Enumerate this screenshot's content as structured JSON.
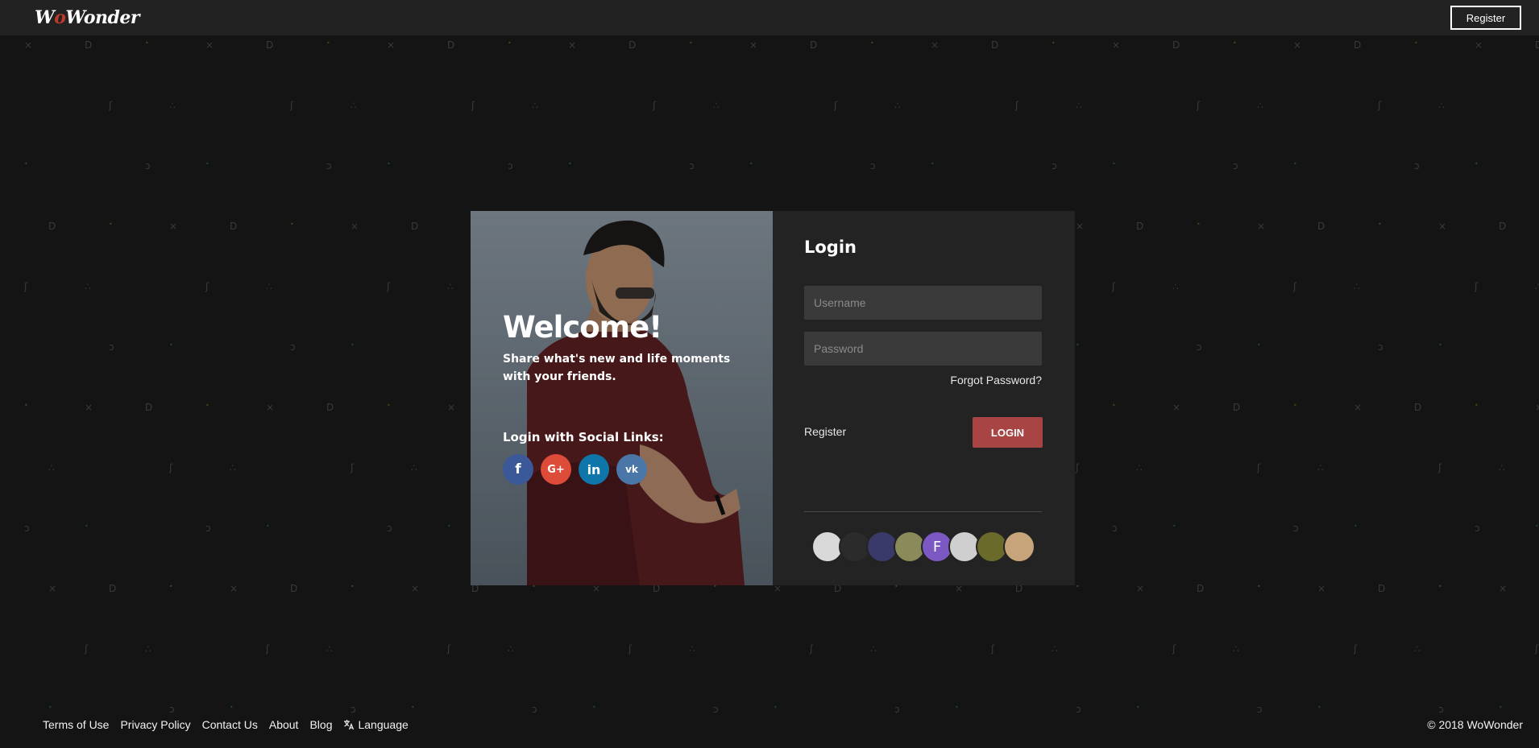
{
  "header": {
    "logo_text_start": "W",
    "logo_text_o": "o",
    "logo_text_end": "Wonder",
    "register_label": "Register"
  },
  "hero": {
    "welcome": "Welcome!",
    "tagline": "Share what's new and life moments with your friends.",
    "social_title": "Login with Social Links:",
    "social": [
      {
        "glyph": "f",
        "service": "facebook"
      },
      {
        "glyph": "G+",
        "service": "google-plus"
      },
      {
        "glyph": "in",
        "service": "linkedin"
      },
      {
        "glyph": "vk",
        "service": "vk"
      }
    ]
  },
  "login": {
    "title": "Login",
    "username_placeholder": "Username",
    "password_placeholder": "Password",
    "forgot": "Forgot Password?",
    "register": "Register",
    "submit": "LOGIN"
  },
  "avatars": [
    {
      "letter": "",
      "color": "#d9d9d9"
    },
    {
      "letter": "",
      "color": "#2b2b2b"
    },
    {
      "letter": "",
      "color": "#3a3a6a"
    },
    {
      "letter": "",
      "color": "#8a8a5a"
    },
    {
      "letter": "F",
      "color": "#7b58c2"
    },
    {
      "letter": "",
      "color": "#cfcfcf"
    },
    {
      "letter": "",
      "color": "#6a6a2a"
    },
    {
      "letter": "",
      "color": "#c8a47a"
    }
  ],
  "footer": {
    "links": [
      "Terms of Use",
      "Privacy Policy",
      "Contact Us",
      "About",
      "Blog"
    ],
    "language": "Language",
    "copyright": "© 2018 WoWonder"
  },
  "colors": {
    "background": "#141414",
    "topbar": "#222222",
    "login_button": "#a84444",
    "panel": "#232323"
  }
}
